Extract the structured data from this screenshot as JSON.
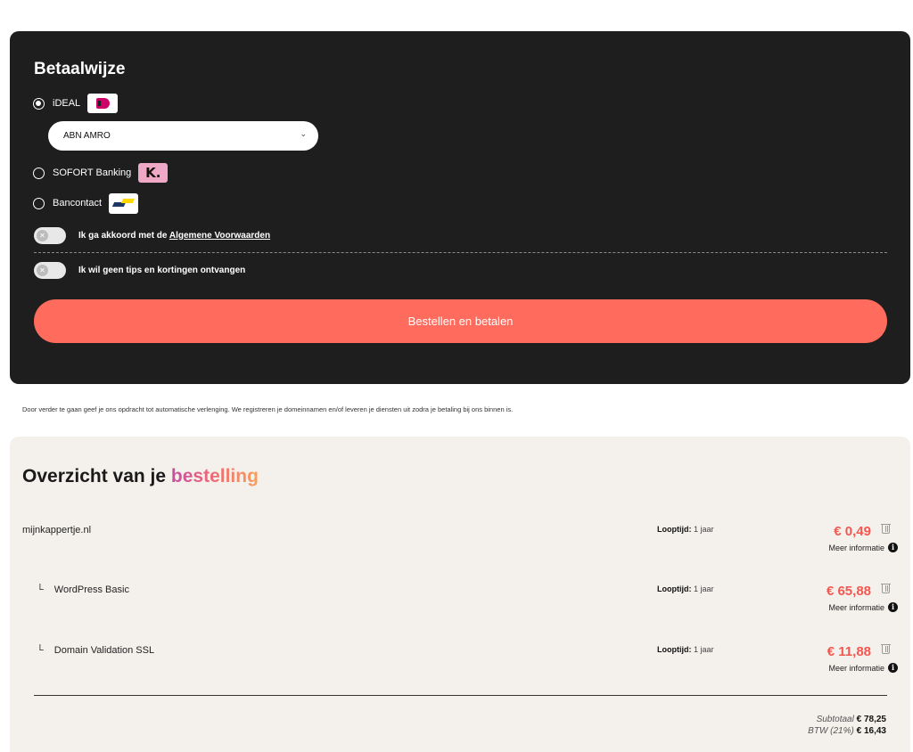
{
  "payment": {
    "title": "Betaalwijze",
    "methods": [
      {
        "label": "iDEAL",
        "selected": true,
        "logo": "ideal-logo"
      },
      {
        "label": "SOFORT Banking",
        "selected": false,
        "logo": "klarna-logo",
        "logo_text": "K."
      },
      {
        "label": "Bancontact",
        "selected": false,
        "logo": "bancontact-logo"
      }
    ],
    "bank_select": {
      "value": "ABN AMRO"
    },
    "terms_toggle": {
      "text": "Ik ga akkoord met de ",
      "link": "Algemene Voorwaarden",
      "on": false
    },
    "tips_toggle": {
      "text": "Ik wil geen tips en kortingen ontvangen",
      "on": false
    },
    "cta_label": "Bestellen en betalen"
  },
  "disclaimer": "Door verder te gaan geef je ons opdracht tot automatische verlenging. We registreren je domeinnamen en/of leveren je diensten uit zodra je betaling bij ons binnen is.",
  "order": {
    "title_main": "Overzicht van je ",
    "title_accent": "bestelling",
    "items": [
      {
        "name": "mijnkappertje.nl",
        "sub": false,
        "term_label": "Looptijd:",
        "term_value": " 1 jaar",
        "price": "€ 0,49",
        "more_info": "Meer informatie"
      },
      {
        "name": "WordPress Basic",
        "sub": true,
        "term_label": "Looptijd:",
        "term_value": " 1 jaar",
        "price": "€ 65,88",
        "more_info": "Meer informatie"
      },
      {
        "name": "Domain Validation SSL",
        "sub": true,
        "term_label": "Looptijd:",
        "term_value": " 1 jaar",
        "price": "€ 11,88",
        "more_info": "Meer informatie"
      }
    ],
    "branch_glyph": "└",
    "subtotal_label": "Subtotaal",
    "subtotal_value": "€ 78,25",
    "vat_label": "BTW (21%)",
    "vat_value": "€ 16,43"
  },
  "colors": {
    "card_dark": "#1e1e1e",
    "cta": "#ff6b5c",
    "price": "#f4574f",
    "order_bg": "#f4f1ec"
  }
}
